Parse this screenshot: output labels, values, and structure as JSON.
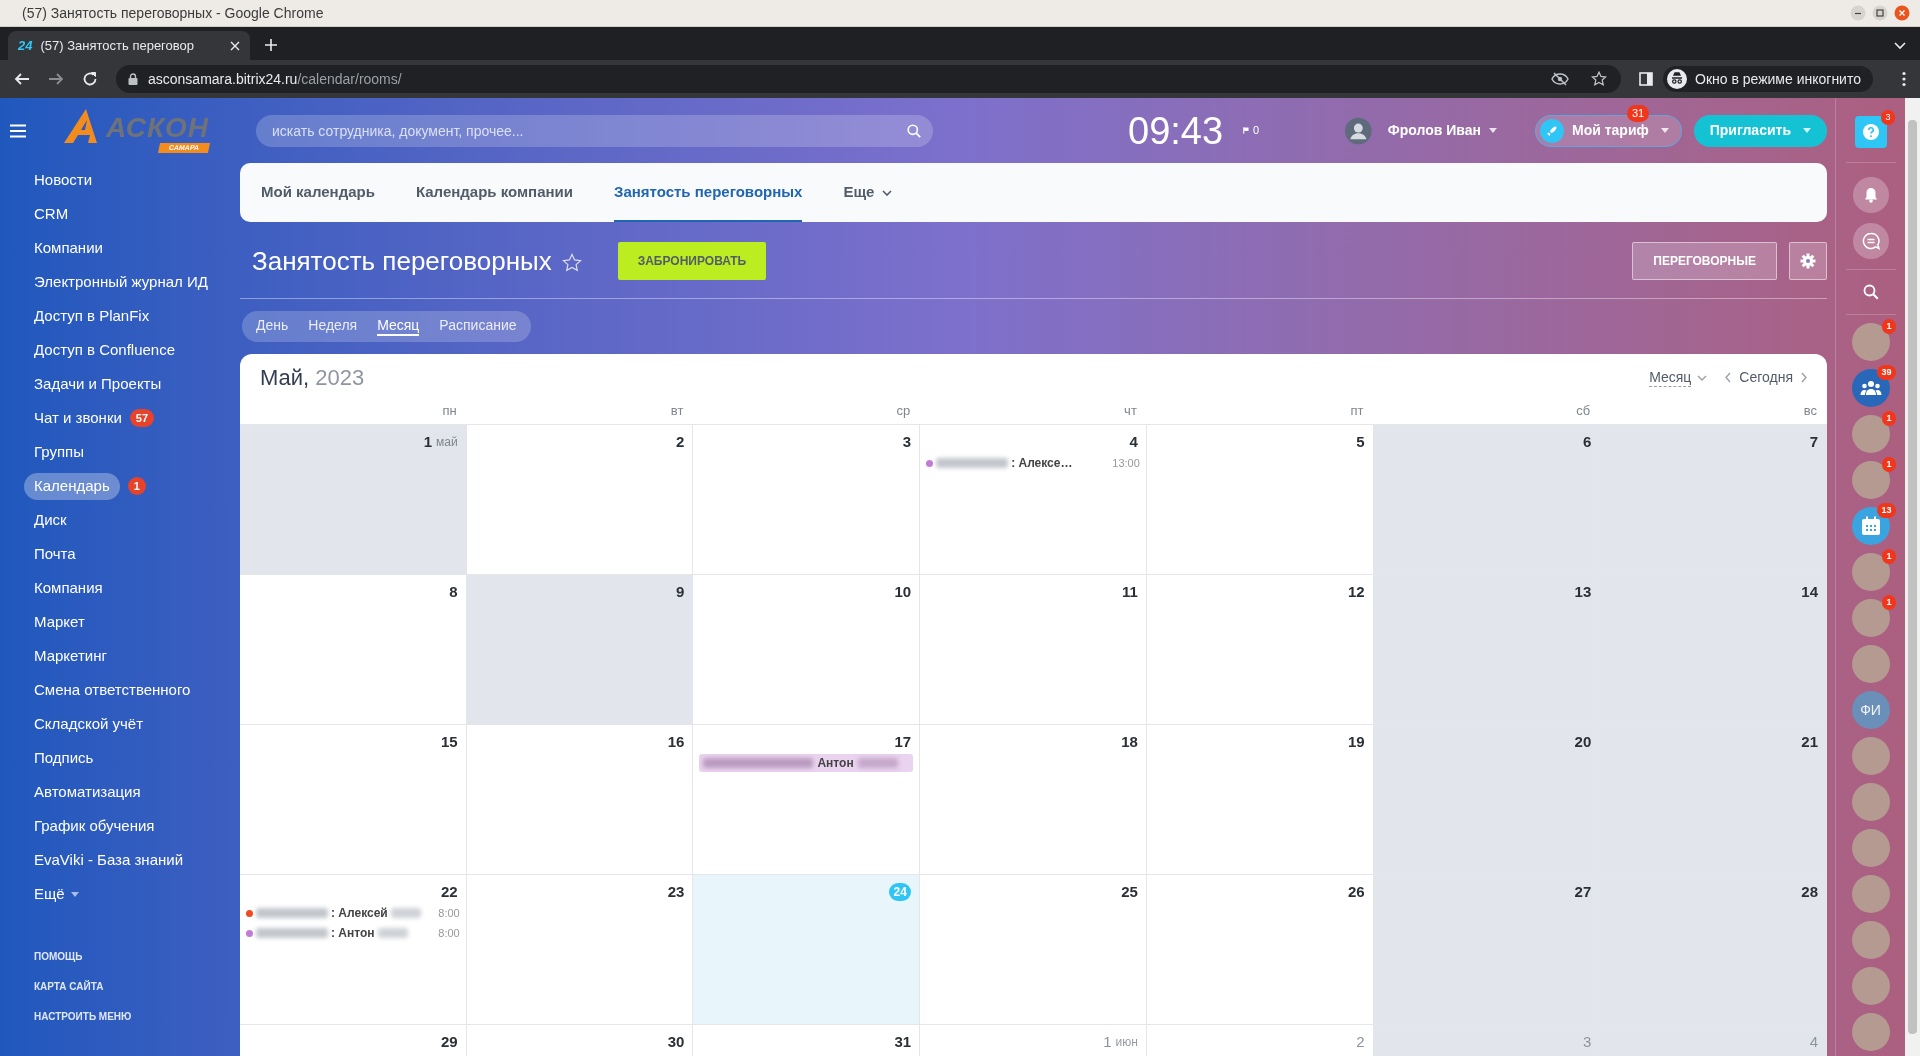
{
  "window": {
    "title": "(57) Занятость переговорных - Google Chrome"
  },
  "browser": {
    "favicon_text": "24",
    "tab_title": "(57) Занятость переговор",
    "url_host": "asconsamara.bitrix24.ru",
    "url_path": "/calendar/rooms/",
    "incognito_label": "Окно в режиме инкогнито"
  },
  "logo": {
    "name": "АСКОН",
    "sub": "САМАРА"
  },
  "header": {
    "search_placeholder": "искать сотрудника, документ, прочее...",
    "clock": "09:43",
    "flag_count": "0",
    "user_name": "Фролов Иван",
    "tariff": {
      "label": "Мой тариф",
      "badge": "31"
    },
    "invite": "Пригласить"
  },
  "sidebar": {
    "items": [
      {
        "label": "Новости",
        "selected": false,
        "dropdown": false
      },
      {
        "label": "CRM",
        "selected": false,
        "dropdown": false
      },
      {
        "label": "Компании",
        "selected": false,
        "dropdown": false
      },
      {
        "label": "Электронный журнал ИД",
        "selected": false,
        "dropdown": false
      },
      {
        "label": "Доступ в PlanFix",
        "selected": false,
        "dropdown": false
      },
      {
        "label": "Доступ в Confluence",
        "selected": false,
        "dropdown": false
      },
      {
        "label": "Задачи и Проекты",
        "selected": false,
        "dropdown": false
      },
      {
        "label": "Чат и звонки",
        "selected": false,
        "dropdown": false,
        "badge": "57"
      },
      {
        "label": "Группы",
        "selected": false,
        "dropdown": false
      },
      {
        "label": "Календарь",
        "selected": true,
        "dropdown": false,
        "badge": "1"
      },
      {
        "label": "Диск",
        "selected": false,
        "dropdown": false
      },
      {
        "label": "Почта",
        "selected": false,
        "dropdown": false
      },
      {
        "label": "Компания",
        "selected": false,
        "dropdown": false
      },
      {
        "label": "Маркет",
        "selected": false,
        "dropdown": false
      },
      {
        "label": "Маркетинг",
        "selected": false,
        "dropdown": false
      },
      {
        "label": "Смена ответственного",
        "selected": false,
        "dropdown": false
      },
      {
        "label": "Складской учёт",
        "selected": false,
        "dropdown": false
      },
      {
        "label": "Подпись",
        "selected": false,
        "dropdown": false
      },
      {
        "label": "Автоматизация",
        "selected": false,
        "dropdown": false
      },
      {
        "label": "График обучения",
        "selected": false,
        "dropdown": false
      },
      {
        "label": "EvaViki - База знаний",
        "selected": false,
        "dropdown": false
      },
      {
        "label": "Ещё",
        "selected": false,
        "dropdown": true
      }
    ],
    "footer_links": [
      "ПОМОЩЬ",
      "КАРТА САЙТА",
      "НАСТРОИТЬ МЕНЮ"
    ]
  },
  "top_tabs": [
    {
      "label": "Мой календарь",
      "selected": false,
      "dropdown": false
    },
    {
      "label": "Календарь компании",
      "selected": false,
      "dropdown": false
    },
    {
      "label": "Занятость переговорных",
      "selected": true,
      "dropdown": false
    },
    {
      "label": "Еще",
      "selected": false,
      "dropdown": true
    }
  ],
  "page": {
    "title": "Занятость переговорных",
    "favorite": false,
    "book_button": "ЗАБРОНИРОВАТЬ",
    "rooms_button": "ПЕРЕГОВОРНЫЕ"
  },
  "view_tabs": [
    {
      "label": "День",
      "selected": false
    },
    {
      "label": "Неделя",
      "selected": false
    },
    {
      "label": "Месяц",
      "selected": true
    },
    {
      "label": "Расписание",
      "selected": false
    }
  ],
  "calendar": {
    "month": "Май,",
    "year": "2023",
    "view_select": "Месяц",
    "today_button": "Сегодня",
    "weekdays": [
      "пн",
      "вт",
      "ср",
      "чт",
      "пт",
      "сб",
      "вс"
    ],
    "weeks": [
      [
        {
          "day": "1",
          "month_label": "май",
          "shaded": true,
          "today": false,
          "other_month": false
        },
        {
          "day": "2",
          "shaded": false,
          "today": false,
          "other_month": false
        },
        {
          "day": "3",
          "shaded": false,
          "today": false,
          "other_month": false
        },
        {
          "day": "4",
          "shaded": false,
          "today": false,
          "other_month": false,
          "events": [
            {
              "kind": "dot",
              "color": "#c27bd6",
              "redacted_before": true,
              "text": ": Алексе…",
              "redacted_after": false,
              "time": "13:00"
            }
          ]
        },
        {
          "day": "5",
          "shaded": false,
          "today": false,
          "other_month": false
        },
        {
          "day": "6",
          "shaded": true,
          "today": false,
          "other_month": false
        },
        {
          "day": "7",
          "shaded": true,
          "today": false,
          "other_month": false
        }
      ],
      [
        {
          "day": "8",
          "shaded": false,
          "today": false,
          "other_month": false
        },
        {
          "day": "9",
          "shaded": true,
          "today": false,
          "other_month": false
        },
        {
          "day": "10",
          "shaded": false,
          "today": false,
          "other_month": false
        },
        {
          "day": "11",
          "shaded": false,
          "today": false,
          "other_month": false
        },
        {
          "day": "12",
          "shaded": false,
          "today": false,
          "other_month": false
        },
        {
          "day": "13",
          "shaded": true,
          "today": false,
          "other_month": false
        },
        {
          "day": "14",
          "shaded": true,
          "today": false,
          "other_month": false
        }
      ],
      [
        {
          "day": "15",
          "shaded": false,
          "today": false,
          "other_month": false
        },
        {
          "day": "16",
          "shaded": false,
          "today": false,
          "other_month": false
        },
        {
          "day": "17",
          "shaded": false,
          "today": false,
          "other_month": false,
          "events": [
            {
              "kind": "bar",
              "color": "#ead3ef",
              "redacted_before": true,
              "text": "Антон",
              "redacted_after": true
            }
          ]
        },
        {
          "day": "18",
          "shaded": false,
          "today": false,
          "other_month": false
        },
        {
          "day": "19",
          "shaded": false,
          "today": false,
          "other_month": false
        },
        {
          "day": "20",
          "shaded": true,
          "today": false,
          "other_month": false
        },
        {
          "day": "21",
          "shaded": true,
          "today": false,
          "other_month": false
        }
      ],
      [
        {
          "day": "22",
          "shaded": false,
          "today": false,
          "other_month": false,
          "events": [
            {
              "kind": "dot",
              "color": "#f04a22",
              "redacted_before": true,
              "text": ": Алексей",
              "redacted_after": true,
              "time": "8:00"
            },
            {
              "kind": "dot",
              "color": "#c27bd6",
              "redacted_before": true,
              "text": ": Антон",
              "redacted_after": true,
              "time": "8:00"
            }
          ]
        },
        {
          "day": "23",
          "shaded": false,
          "today": false,
          "other_month": false
        },
        {
          "day": "24",
          "shaded": false,
          "today": true,
          "other_month": false
        },
        {
          "day": "25",
          "shaded": false,
          "today": false,
          "other_month": false
        },
        {
          "day": "26",
          "shaded": false,
          "today": false,
          "other_month": false
        },
        {
          "day": "27",
          "shaded": true,
          "today": false,
          "other_month": false
        },
        {
          "day": "28",
          "shaded": true,
          "today": false,
          "other_month": false
        }
      ],
      [
        {
          "day": "29",
          "shaded": false,
          "today": false,
          "other_month": false
        },
        {
          "day": "30",
          "shaded": false,
          "today": false,
          "other_month": false
        },
        {
          "day": "31",
          "shaded": false,
          "today": false,
          "other_month": false
        },
        {
          "day": "1",
          "month_label": "июн",
          "shaded": false,
          "today": false,
          "other_month": true
        },
        {
          "day": "2",
          "shaded": false,
          "today": false,
          "other_month": true
        },
        {
          "day": "3",
          "shaded": true,
          "today": false,
          "other_month": true
        },
        {
          "day": "4",
          "shaded": true,
          "today": false,
          "other_month": true
        }
      ]
    ]
  },
  "right_panel": {
    "help_badge": "3",
    "contacts": [
      {
        "kind": "photo",
        "badge": "1"
      },
      {
        "kind": "group",
        "badge": "39"
      },
      {
        "kind": "photo",
        "badge": "1"
      },
      {
        "kind": "photo",
        "badge": "1"
      },
      {
        "kind": "calendar",
        "badge": "13"
      },
      {
        "kind": "photo",
        "badge": "1"
      },
      {
        "kind": "photo",
        "badge": "1"
      },
      {
        "kind": "photo"
      },
      {
        "kind": "initials",
        "initials": "ФИ"
      },
      {
        "kind": "photo"
      },
      {
        "kind": "photo"
      },
      {
        "kind": "photo"
      },
      {
        "kind": "photo"
      },
      {
        "kind": "photo"
      },
      {
        "kind": "photo"
      },
      {
        "kind": "photo"
      }
    ]
  }
}
